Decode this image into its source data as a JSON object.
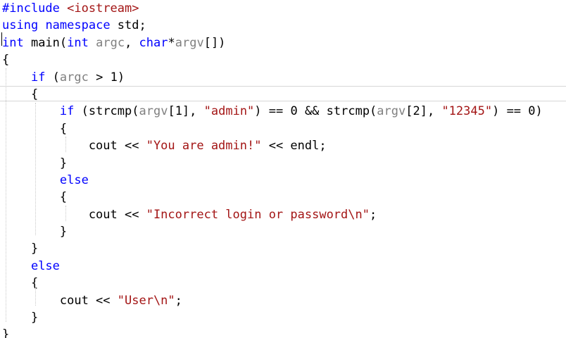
{
  "editor": {
    "lines": [
      {
        "tokens": [
          {
            "t": "#include",
            "c": "kw"
          },
          {
            "t": " ",
            "c": "plain"
          },
          {
            "t": "<iostream>",
            "c": "str"
          }
        ]
      },
      {
        "tokens": [
          {
            "t": "using",
            "c": "kw"
          },
          {
            "t": " ",
            "c": "plain"
          },
          {
            "t": "namespace",
            "c": "kw"
          },
          {
            "t": " std;",
            "c": "plain"
          }
        ]
      },
      {
        "tokens": [
          {
            "t": "int",
            "c": "kw"
          },
          {
            "t": " main(",
            "c": "plain"
          },
          {
            "t": "int",
            "c": "kw"
          },
          {
            "t": " ",
            "c": "plain"
          },
          {
            "t": "argc",
            "c": "prm"
          },
          {
            "t": ", ",
            "c": "plain"
          },
          {
            "t": "char",
            "c": "kw"
          },
          {
            "t": "*",
            "c": "plain"
          },
          {
            "t": "argv",
            "c": "prm"
          },
          {
            "t": "[])",
            "c": "plain"
          }
        ]
      },
      {
        "tokens": [
          {
            "t": "{",
            "c": "plain"
          }
        ]
      },
      {
        "tokens": [
          {
            "t": "    ",
            "c": "plain"
          },
          {
            "t": "if",
            "c": "kw"
          },
          {
            "t": " (",
            "c": "plain"
          },
          {
            "t": "argc",
            "c": "prm"
          },
          {
            "t": " > 1)",
            "c": "plain"
          }
        ]
      },
      {
        "current": true,
        "tokens": [
          {
            "t": "    {",
            "c": "plain"
          }
        ]
      },
      {
        "tokens": [
          {
            "t": "        ",
            "c": "plain"
          },
          {
            "t": "if",
            "c": "kw"
          },
          {
            "t": " (strcmp(",
            "c": "plain"
          },
          {
            "t": "argv",
            "c": "prm"
          },
          {
            "t": "[1], ",
            "c": "plain"
          },
          {
            "t": "\"admin\"",
            "c": "str"
          },
          {
            "t": ") == 0 && strcmp(",
            "c": "plain"
          },
          {
            "t": "argv",
            "c": "prm"
          },
          {
            "t": "[2], ",
            "c": "plain"
          },
          {
            "t": "\"12345\"",
            "c": "str"
          },
          {
            "t": ") == 0)",
            "c": "plain"
          }
        ]
      },
      {
        "tokens": [
          {
            "t": "        {",
            "c": "plain"
          }
        ]
      },
      {
        "tokens": [
          {
            "t": "            cout << ",
            "c": "plain"
          },
          {
            "t": "\"You are admin!\"",
            "c": "str"
          },
          {
            "t": " << endl;",
            "c": "plain"
          }
        ]
      },
      {
        "tokens": [
          {
            "t": "        }",
            "c": "plain"
          }
        ]
      },
      {
        "tokens": [
          {
            "t": "        ",
            "c": "plain"
          },
          {
            "t": "else",
            "c": "kw"
          }
        ]
      },
      {
        "tokens": [
          {
            "t": "        {",
            "c": "plain"
          }
        ]
      },
      {
        "tokens": [
          {
            "t": "            cout << ",
            "c": "plain"
          },
          {
            "t": "\"Incorrect login or password\\n\"",
            "c": "str"
          },
          {
            "t": ";",
            "c": "plain"
          }
        ]
      },
      {
        "tokens": [
          {
            "t": "        }",
            "c": "plain"
          }
        ]
      },
      {
        "tokens": [
          {
            "t": "    }",
            "c": "plain"
          }
        ]
      },
      {
        "tokens": [
          {
            "t": "    ",
            "c": "plain"
          },
          {
            "t": "else",
            "c": "kw"
          }
        ]
      },
      {
        "tokens": [
          {
            "t": "    {",
            "c": "plain"
          }
        ]
      },
      {
        "tokens": [
          {
            "t": "        cout << ",
            "c": "plain"
          },
          {
            "t": "\"User\\n\"",
            "c": "str"
          },
          {
            "t": ";",
            "c": "plain"
          }
        ]
      },
      {
        "tokens": [
          {
            "t": "    }",
            "c": "plain"
          }
        ]
      },
      {
        "tokens": [
          {
            "t": "}",
            "c": "plain"
          }
        ]
      }
    ]
  },
  "colors": {
    "keyword": "#0000ff",
    "string": "#a31515",
    "parameter": "#808080",
    "plain": "#000000",
    "background": "#ffffff",
    "current_line_border": "#d6d6d6",
    "indent_guide": "#c8c8c8"
  }
}
